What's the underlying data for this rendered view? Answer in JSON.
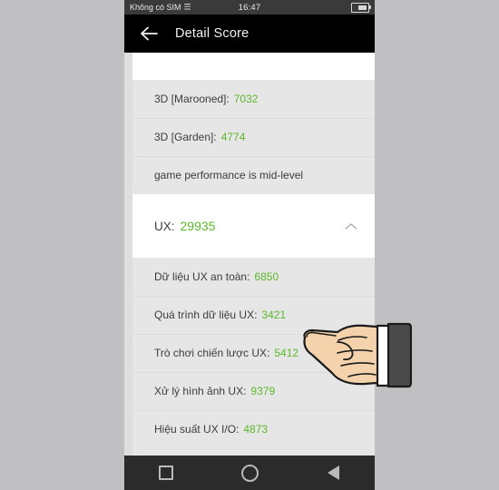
{
  "status_bar": {
    "carrier": "Không có SIM",
    "wifi_icon": "wifi-icon",
    "clock": "16:47",
    "battery_icon": "battery-icon"
  },
  "header": {
    "back_icon": "arrow-left-icon",
    "title": "Detail Score"
  },
  "content": {
    "top_rows": [
      {
        "label": "3D [Marooned]:",
        "value": "7032"
      },
      {
        "label": "3D [Garden]:",
        "value": "4774"
      },
      {
        "label": "game performance is mid-level",
        "value": ""
      }
    ],
    "section": {
      "label": "UX:",
      "value": "29935",
      "chevron_icon": "chevron-up-icon"
    },
    "section_rows": [
      {
        "label": "Dữ liệu UX an toàn:",
        "value": "6850"
      },
      {
        "label": "Quá trình dữ liệu UX:",
        "value": "3421"
      },
      {
        "label": "Trò chơi chiến lược UX:",
        "value": "5412"
      },
      {
        "label": "Xử lý hình ảnh UX:",
        "value": "9379"
      },
      {
        "label": "Hiệu suất UX I/O:",
        "value": "4873"
      }
    ]
  },
  "nav_bar": {
    "recents_icon": "square-icon",
    "home_icon": "circle-icon",
    "back_icon": "triangle-back-icon"
  },
  "overlay": {
    "pointer_icon": "pointing-hand-icon"
  },
  "colors": {
    "score_green": "#5cb82b",
    "header_black": "#000000",
    "page_background": "#c0bfc1",
    "row_background": "#e6e6e6",
    "card_background": "#ffffff"
  }
}
